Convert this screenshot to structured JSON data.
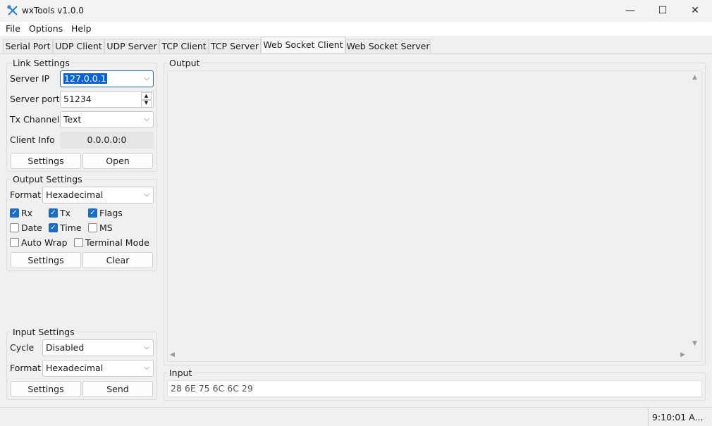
{
  "window": {
    "title": "wxTools v1.0.0",
    "minimize": "—",
    "maximize": "☐",
    "close": "✕"
  },
  "menu": [
    "File",
    "Options",
    "Help"
  ],
  "tabs": [
    "Serial Port",
    "UDP Client",
    "UDP Server",
    "TCP Client",
    "TCP Server",
    "Web Socket Client",
    "Web Socket Server"
  ],
  "active_tab": "Web Socket Client",
  "link_settings": {
    "title": "Link Settings",
    "server_ip_label": "Server IP",
    "server_ip": "127.0.0.1",
    "server_port_label": "Server port",
    "server_port": "51234",
    "tx_channel_label": "Tx Channel",
    "tx_channel": "Text",
    "client_info_label": "Client Info",
    "client_info": "0.0.0.0:0",
    "settings_button": "Settings",
    "open_button": "Open"
  },
  "output_settings": {
    "title": "Output Settings",
    "format_label": "Format",
    "format": "Hexadecimal",
    "checkboxes": {
      "rx": {
        "label": "Rx",
        "checked": true
      },
      "tx": {
        "label": "Tx",
        "checked": true
      },
      "flags": {
        "label": "Flags",
        "checked": true
      },
      "date": {
        "label": "Date",
        "checked": false
      },
      "time": {
        "label": "Time",
        "checked": true
      },
      "ms": {
        "label": "MS",
        "checked": false
      },
      "auto_wrap": {
        "label": "Auto Wrap",
        "checked": false
      },
      "terminal_mode": {
        "label": "Terminal Mode",
        "checked": false
      }
    },
    "settings_button": "Settings",
    "clear_button": "Clear"
  },
  "input_settings": {
    "title": "Input Settings",
    "cycle_label": "Cycle",
    "cycle": "Disabled",
    "format_label": "Format",
    "format": "Hexadecimal",
    "settings_button": "Settings",
    "send_button": "Send"
  },
  "output_panel": {
    "title": "Output",
    "text": ""
  },
  "input_panel": {
    "title": "Input",
    "value": "28 6E 75 6C 6C 29"
  },
  "status": {
    "time": "9:10:01 A..."
  },
  "colors": {
    "accent": "#1b6ec2",
    "selection": "#0a64d6"
  }
}
